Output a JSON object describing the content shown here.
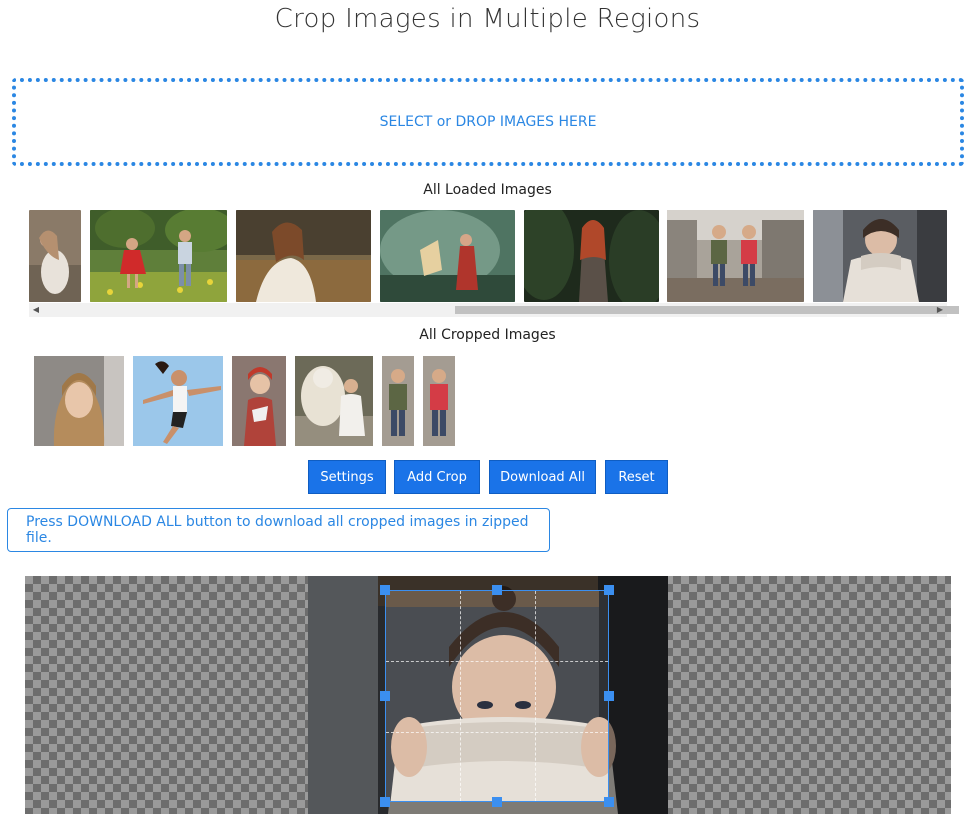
{
  "page": {
    "title": "Crop Images in Multiple Regions"
  },
  "dropzone": {
    "label": "SELECT or DROP IMAGES HERE"
  },
  "loaded": {
    "heading": "All Loaded Images",
    "images": [
      {
        "name": "girl-white-dress-rocks"
      },
      {
        "name": "kids-in-park"
      },
      {
        "name": "woman-autumn-field"
      },
      {
        "name": "woman-with-fan-mist"
      },
      {
        "name": "redhead-in-garden"
      },
      {
        "name": "two-kids-on-bridge"
      },
      {
        "name": "woman-sweater-face"
      }
    ]
  },
  "cropped": {
    "heading": "All Cropped Images",
    "images": [
      {
        "name": "crop-blonde-woman"
      },
      {
        "name": "crop-jumping-woman"
      },
      {
        "name": "crop-girl-red-hat"
      },
      {
        "name": "crop-girl-with-tiger"
      },
      {
        "name": "crop-boy-green-jacket"
      },
      {
        "name": "crop-girl-red-coat"
      }
    ]
  },
  "toolbar": {
    "settings": "Settings",
    "add_crop": "Add Crop",
    "download_all": "Download All",
    "reset": "Reset"
  },
  "notice": {
    "text": "Press DOWNLOAD ALL button to download all cropped images in zipped file."
  },
  "colors": {
    "accent": "#1a73e8",
    "crop_border": "#3b8ff0"
  }
}
